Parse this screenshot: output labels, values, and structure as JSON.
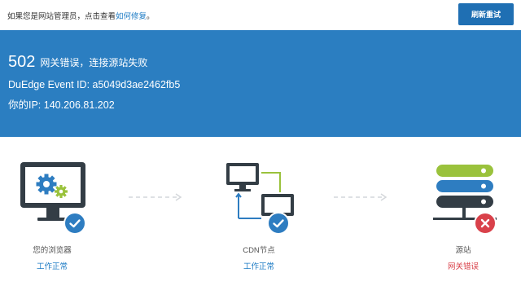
{
  "notice": {
    "text": "如果您是网站管理员，点击查看",
    "link": "如何修复",
    "suffix": "。"
  },
  "refresh_button": "刷新重试",
  "error": {
    "code": "502",
    "message": "网关错误，连接源站失败",
    "event_id_line": "DuEdge Event ID: a5049d3ae2462fb5",
    "ip_line": "你的IP: 140.206.81.202"
  },
  "steps": [
    {
      "label": "您的浏览器",
      "status": "工作正常",
      "icon": "browser-monitor-icon",
      "badge": "check"
    },
    {
      "label": "CDN节点",
      "status": "工作正常",
      "icon": "cdn-nodes-icon",
      "badge": "check"
    },
    {
      "label": "源站",
      "status": "网关错误",
      "icon": "origin-server-icon",
      "badge": "error"
    }
  ],
  "colors": {
    "banner": "#2b7ec1",
    "button": "#1f6fb3",
    "ok": "#1c7bc4",
    "error": "#d9414a",
    "server_green": "#9ac23c",
    "server_blue": "#2e7dc1",
    "server_dark": "#333d45"
  }
}
